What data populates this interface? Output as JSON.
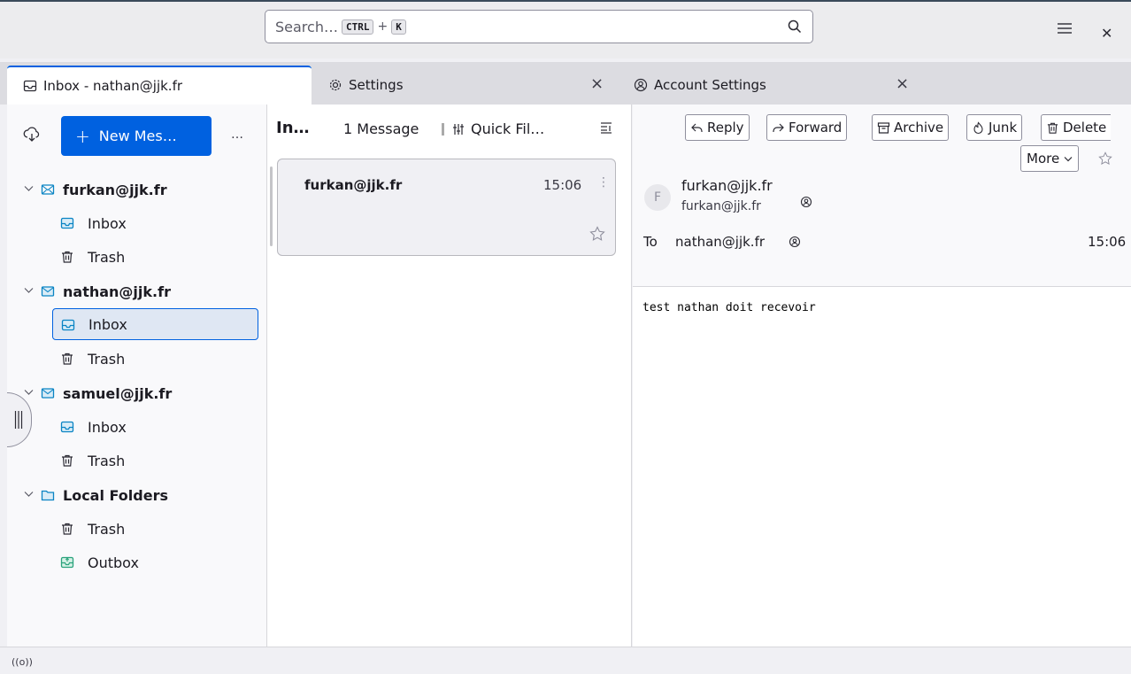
{
  "search": {
    "placeholder": "Search…",
    "shortcut_key1": "CTRL",
    "shortcut_plus": "+",
    "shortcut_key2": "K"
  },
  "tabs": [
    {
      "label": "Inbox - nathan@jjk.fr",
      "icon": "inbox-icon",
      "active": true
    },
    {
      "label": "Settings",
      "icon": "gear-icon",
      "close": "×"
    },
    {
      "label": "Account Settings",
      "icon": "account-settings-icon",
      "close": "×"
    }
  ],
  "folder_pane": {
    "new_message_label": "New Mes…",
    "new_message_plus": "+",
    "more_label": "…",
    "accounts": [
      {
        "name": "furkan@jjk.fr",
        "icon": "mail-account-icon",
        "folders": [
          {
            "label": "Inbox",
            "icon": "inbox-icon"
          },
          {
            "label": "Trash",
            "icon": "trash-icon"
          }
        ]
      },
      {
        "name": "nathan@jjk.fr",
        "icon": "mail-account-icon",
        "folders": [
          {
            "label": "Inbox",
            "icon": "inbox-icon",
            "selected": true
          },
          {
            "label": "Trash",
            "icon": "trash-icon"
          }
        ]
      },
      {
        "name": "samuel@jjk.fr",
        "icon": "mail-account-icon",
        "folders": [
          {
            "label": "Inbox",
            "icon": "inbox-icon"
          },
          {
            "label": "Trash",
            "icon": "trash-icon"
          }
        ]
      },
      {
        "name": "Local Folders",
        "icon": "local-folder-icon",
        "folders": [
          {
            "label": "Trash",
            "icon": "trash-icon"
          },
          {
            "label": "Outbox",
            "icon": "outbox-icon"
          }
        ]
      }
    ]
  },
  "thread_pane": {
    "title": "In…",
    "count": "1 Message",
    "quick_filter_label": "Quick Fil…",
    "messages": [
      {
        "sender": "furkan@jjk.fr",
        "time": "15:06",
        "kebab": "⋮"
      }
    ]
  },
  "message_pane": {
    "buttons": {
      "reply": "Reply",
      "forward": "Forward",
      "archive": "Archive",
      "junk": "Junk",
      "delete": "Delete",
      "more": "More"
    },
    "avatar_letter": "F",
    "from_name": "furkan@jjk.fr",
    "from_address": "furkan@jjk.fr",
    "to_label": "To",
    "to_address": "nathan@jjk.fr",
    "time": "15:06",
    "body": "test nathan doit recevoir"
  },
  "status_bar": {
    "online_indicator": "((o))"
  },
  "colors": {
    "accent": "#0061e0",
    "inbox_icon": "#0a84c4",
    "outbox_icon": "#2ba37d",
    "selected_bg": "#dfe7f3"
  }
}
